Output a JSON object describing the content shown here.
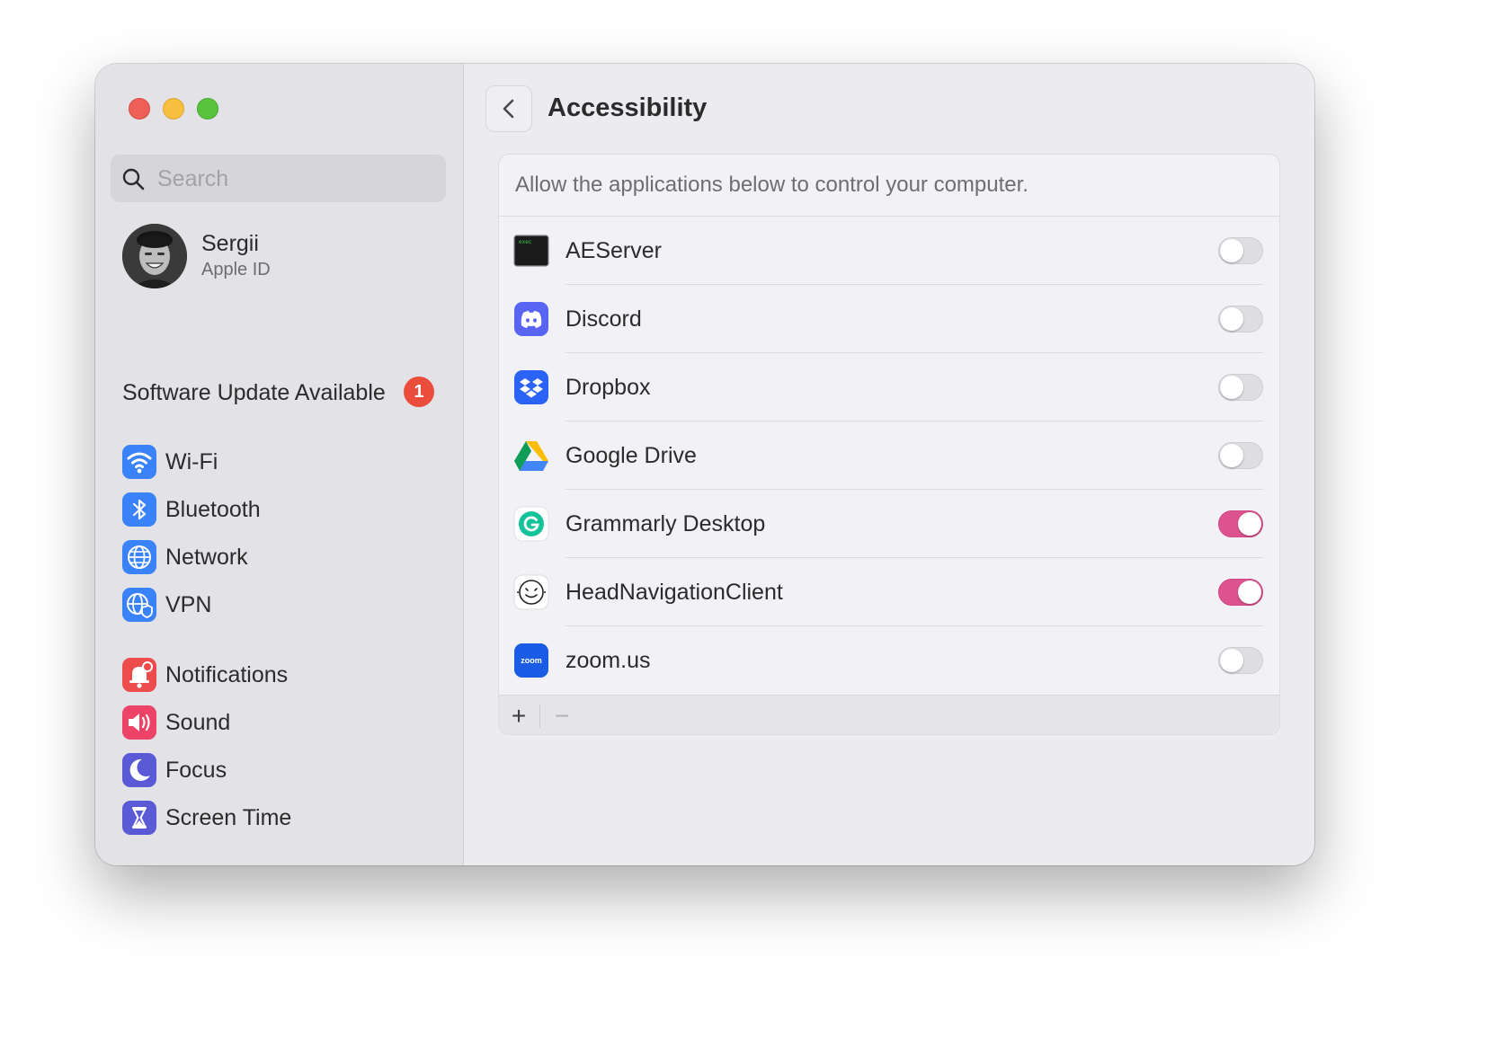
{
  "sidebar": {
    "search": {
      "placeholder": "Search",
      "value": ""
    },
    "profile": {
      "name": "Sergii",
      "subtitle": "Apple ID"
    },
    "update": {
      "label": "Software Update Available",
      "badge": "1"
    },
    "items": [
      {
        "label": "Wi-Fi",
        "icon": "wifi-icon",
        "color": "#3a82f7"
      },
      {
        "label": "Bluetooth",
        "icon": "bluetooth-icon",
        "color": "#3a82f7"
      },
      {
        "label": "Network",
        "icon": "globe-icon",
        "color": "#3a82f7"
      },
      {
        "label": "VPN",
        "icon": "vpn-globe-icon",
        "color": "#3a82f7"
      },
      {
        "label": "Notifications",
        "icon": "bell-icon",
        "color": "#ec4c4b"
      },
      {
        "label": "Sound",
        "icon": "speaker-icon",
        "color": "#ec4366"
      },
      {
        "label": "Focus",
        "icon": "moon-icon",
        "color": "#5b5ad6"
      },
      {
        "label": "Screen Time",
        "icon": "hourglass-icon",
        "color": "#5b5ad6"
      }
    ]
  },
  "main": {
    "title": "Accessibility",
    "description": "Allow the applications below to control your computer.",
    "apps": [
      {
        "name": "AEServer",
        "icon": "terminal-exec-icon",
        "enabled": false
      },
      {
        "name": "Discord",
        "icon": "discord-icon",
        "enabled": false
      },
      {
        "name": "Dropbox",
        "icon": "dropbox-icon",
        "enabled": false
      },
      {
        "name": "Google Drive",
        "icon": "google-drive-icon",
        "enabled": false
      },
      {
        "name": "Grammarly Desktop",
        "icon": "grammarly-icon",
        "enabled": true
      },
      {
        "name": "HeadNavigationClient",
        "icon": "head-navigation-icon",
        "enabled": true
      },
      {
        "name": "zoom.us",
        "icon": "zoom-icon",
        "enabled": false
      }
    ],
    "footer": {
      "add": "+",
      "remove": "−"
    },
    "accent_color": "#dc5390"
  }
}
